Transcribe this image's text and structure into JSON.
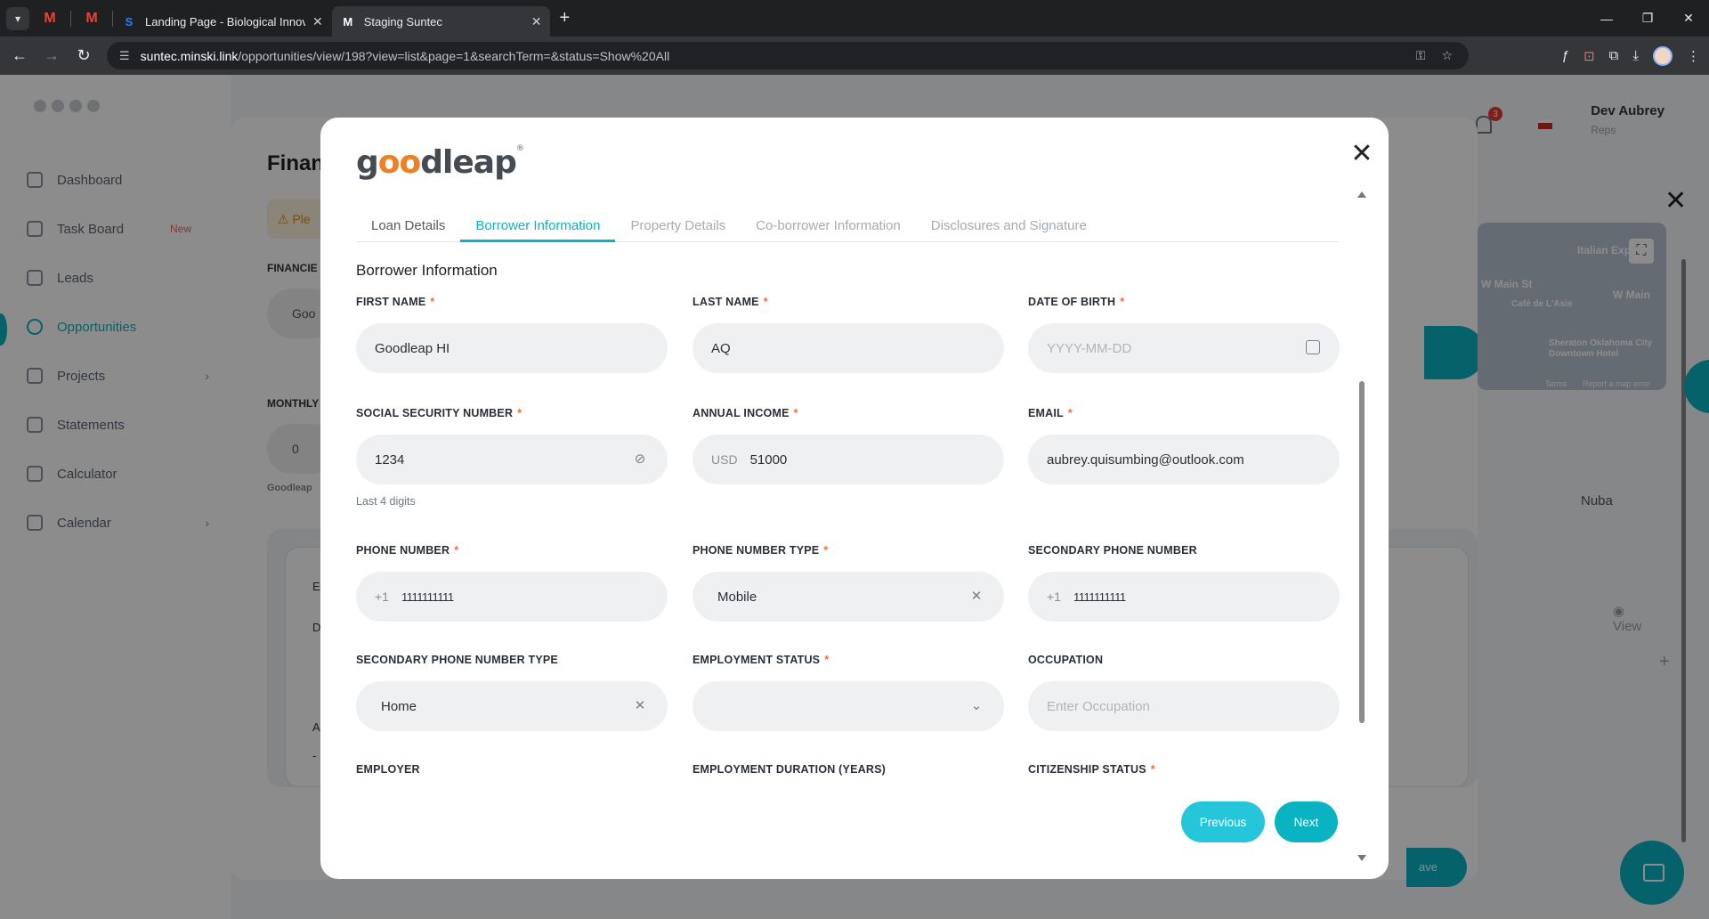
{
  "browser": {
    "tabs": [
      {
        "title": "Landing Page - Biological Innov",
        "close": "✕"
      },
      {
        "title": "Staging Suntec",
        "close": "✕"
      }
    ],
    "url_host": "suntec.minski.link",
    "url_path": "/opportunities/view/198?view=list&page=1&searchTerm=&status=Show%20All"
  },
  "background": {
    "sidebar": {
      "items": [
        {
          "label": "Dashboard"
        },
        {
          "label": "Task Board",
          "badge": "New"
        },
        {
          "label": "Leads"
        },
        {
          "label": "Opportunities"
        },
        {
          "label": "Projects"
        },
        {
          "label": "Statements"
        },
        {
          "label": "Calculator"
        },
        {
          "label": "Calendar"
        }
      ]
    },
    "user": {
      "name": "Dev Aubrey",
      "role": "Reps",
      "notifications": "3"
    },
    "modal_title": "Finan",
    "warning": "Ple",
    "financier_label": "FINANCIE",
    "financier_value": "Goo",
    "monthly_label": "MONTHLY",
    "monthly_value": "0",
    "goodleap_note": "Goodleap",
    "card_a": "E",
    "card_b": "D",
    "card_c": "A",
    "card_d": "-",
    "right_name": "Nuba",
    "view_label": "View",
    "save_label": "ave",
    "map": {
      "s1": "W Main St",
      "s2": "W Main",
      "s3": "Italian Exp",
      "s4": "Café de L'Asie",
      "s5": "Sheraton Oklahoma City Downtown Hotel",
      "terms": "Terms",
      "report": "Report a map error"
    }
  },
  "modal": {
    "brand": "goodleap",
    "tabs": [
      "Loan Details",
      "Borrower Information",
      "Property Details",
      "Co-borrower Information",
      "Disclosures and Signature"
    ],
    "active_tab": "Borrower Information",
    "section_title": "Borrower Information",
    "fields": {
      "first_name": {
        "label": "FIRST NAME",
        "value": "Goodleap HI"
      },
      "last_name": {
        "label": "LAST NAME",
        "value": "AQ"
      },
      "dob": {
        "label": "DATE OF BIRTH",
        "placeholder": "YYYY-MM-DD"
      },
      "ssn": {
        "label": "SOCIAL SECURITY NUMBER",
        "value": "1234",
        "hint": "Last 4 digits"
      },
      "income": {
        "label": "ANNUAL INCOME",
        "currency": "USD",
        "value": "51000"
      },
      "email": {
        "label": "EMAIL",
        "value": "aubrey.quisumbing@outlook.com"
      },
      "phone": {
        "label": "PHONE NUMBER",
        "prefix": "+1",
        "value": "1111111111"
      },
      "phone_type": {
        "label": "PHONE NUMBER TYPE",
        "value": "Mobile"
      },
      "secondary_phone": {
        "label": "SECONDARY PHONE NUMBER",
        "prefix": "+1",
        "value": "1111111111"
      },
      "secondary_phone_type": {
        "label": "SECONDARY PHONE NUMBER TYPE",
        "value": "Home"
      },
      "employment_status": {
        "label": "EMPLOYMENT STATUS",
        "value": ""
      },
      "occupation": {
        "label": "OCCUPATION",
        "placeholder": "Enter Occupation"
      },
      "employer": {
        "label": "EMPLOYER"
      },
      "employment_duration": {
        "label": "EMPLOYMENT DURATION (YEARS)"
      },
      "citizenship": {
        "label": "CITIZENSHIP STATUS"
      }
    },
    "required_mark": "*",
    "buttons": {
      "previous": "Previous",
      "next": "Next"
    }
  },
  "colors": {
    "accent": "#0ab3c1",
    "required": "#ff6a2a",
    "brand_o": "#f07e23"
  }
}
